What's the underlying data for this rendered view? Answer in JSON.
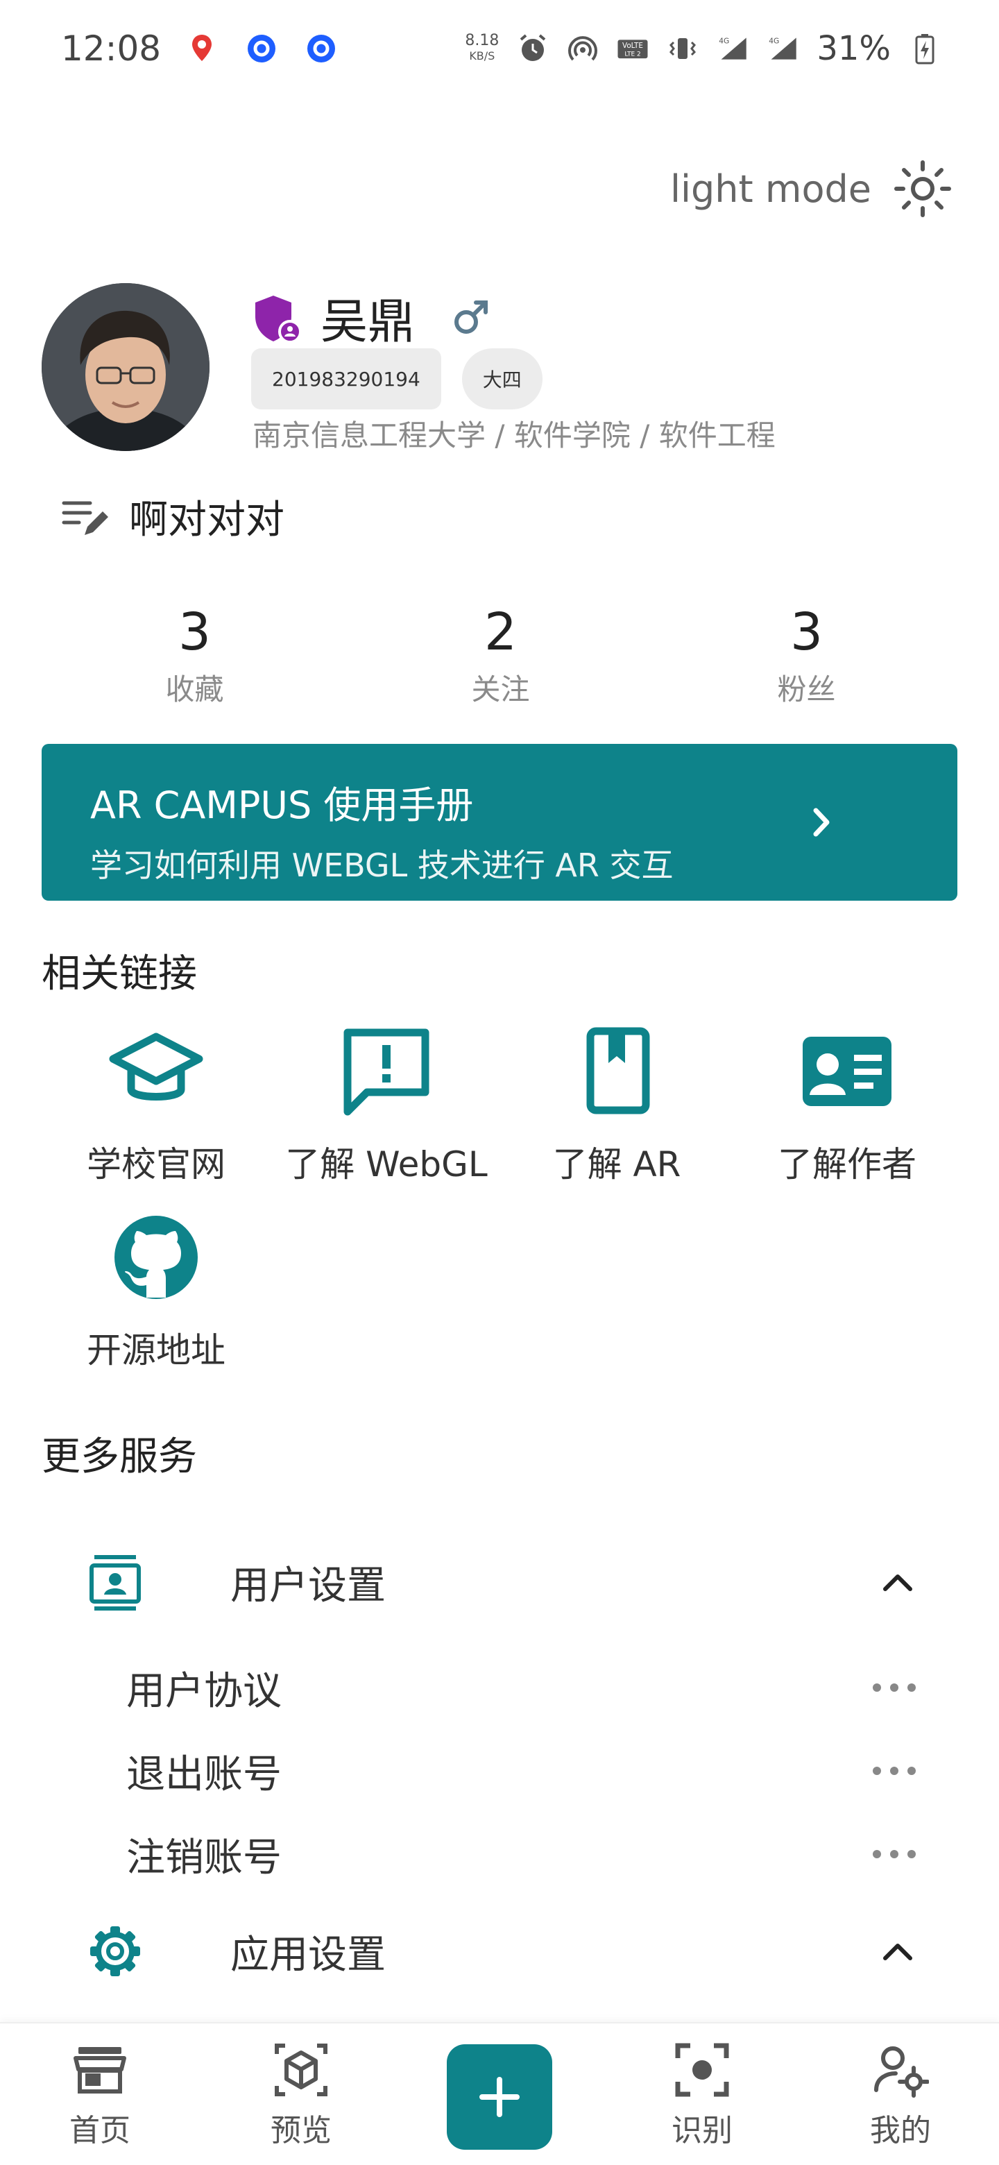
{
  "status_bar": {
    "time": "12:08",
    "net_speed_value": "8.18",
    "net_speed_unit": "KB/S",
    "battery": "31%",
    "network_1": "4G",
    "network_2": "4G"
  },
  "theme": {
    "mode_label": "light mode",
    "icon": "sun-icon"
  },
  "profile": {
    "name": "吴鼎",
    "student_id": "201983290194",
    "grade": "大四",
    "school": "南京信息工程大学 / 软件学院 / 软件工程",
    "signature": "啊对对对",
    "gender_icon": "male-icon"
  },
  "stats": [
    {
      "value": "3",
      "label": "收藏"
    },
    {
      "value": "2",
      "label": "关注"
    },
    {
      "value": "3",
      "label": "粉丝"
    }
  ],
  "banner": {
    "title": "AR CAMPUS 使用手册",
    "subtitle": "学习如何利用 WEBGL 技术进行 AR 交互",
    "color": "#0e838a"
  },
  "links_section": {
    "title": "相关链接",
    "items": [
      {
        "label": "学校官网",
        "icon": "graduation-cap-icon"
      },
      {
        "label": "了解 WebGL",
        "icon": "feedback-icon"
      },
      {
        "label": "了解 AR",
        "icon": "book-icon"
      },
      {
        "label": "了解作者",
        "icon": "contact-card-icon"
      },
      {
        "label": "开源地址",
        "icon": "github-icon"
      }
    ]
  },
  "services_section": {
    "title": "更多服务",
    "groups": [
      {
        "title": "用户设置",
        "icon": "user-badge-icon",
        "items": [
          {
            "label": "用户协议"
          },
          {
            "label": "退出账号"
          },
          {
            "label": "注销账号"
          }
        ]
      },
      {
        "title": "应用设置",
        "icon": "gear-icon",
        "items": []
      }
    ]
  },
  "bottom_nav": {
    "items": [
      {
        "label": "首页",
        "icon": "store-icon"
      },
      {
        "label": "预览",
        "icon": "cube-icon"
      },
      {
        "label": "",
        "icon": "add-icon"
      },
      {
        "label": "识别",
        "icon": "scan-icon"
      },
      {
        "label": "我的",
        "icon": "user-settings-icon"
      }
    ]
  },
  "accent_color": "#0e838a"
}
